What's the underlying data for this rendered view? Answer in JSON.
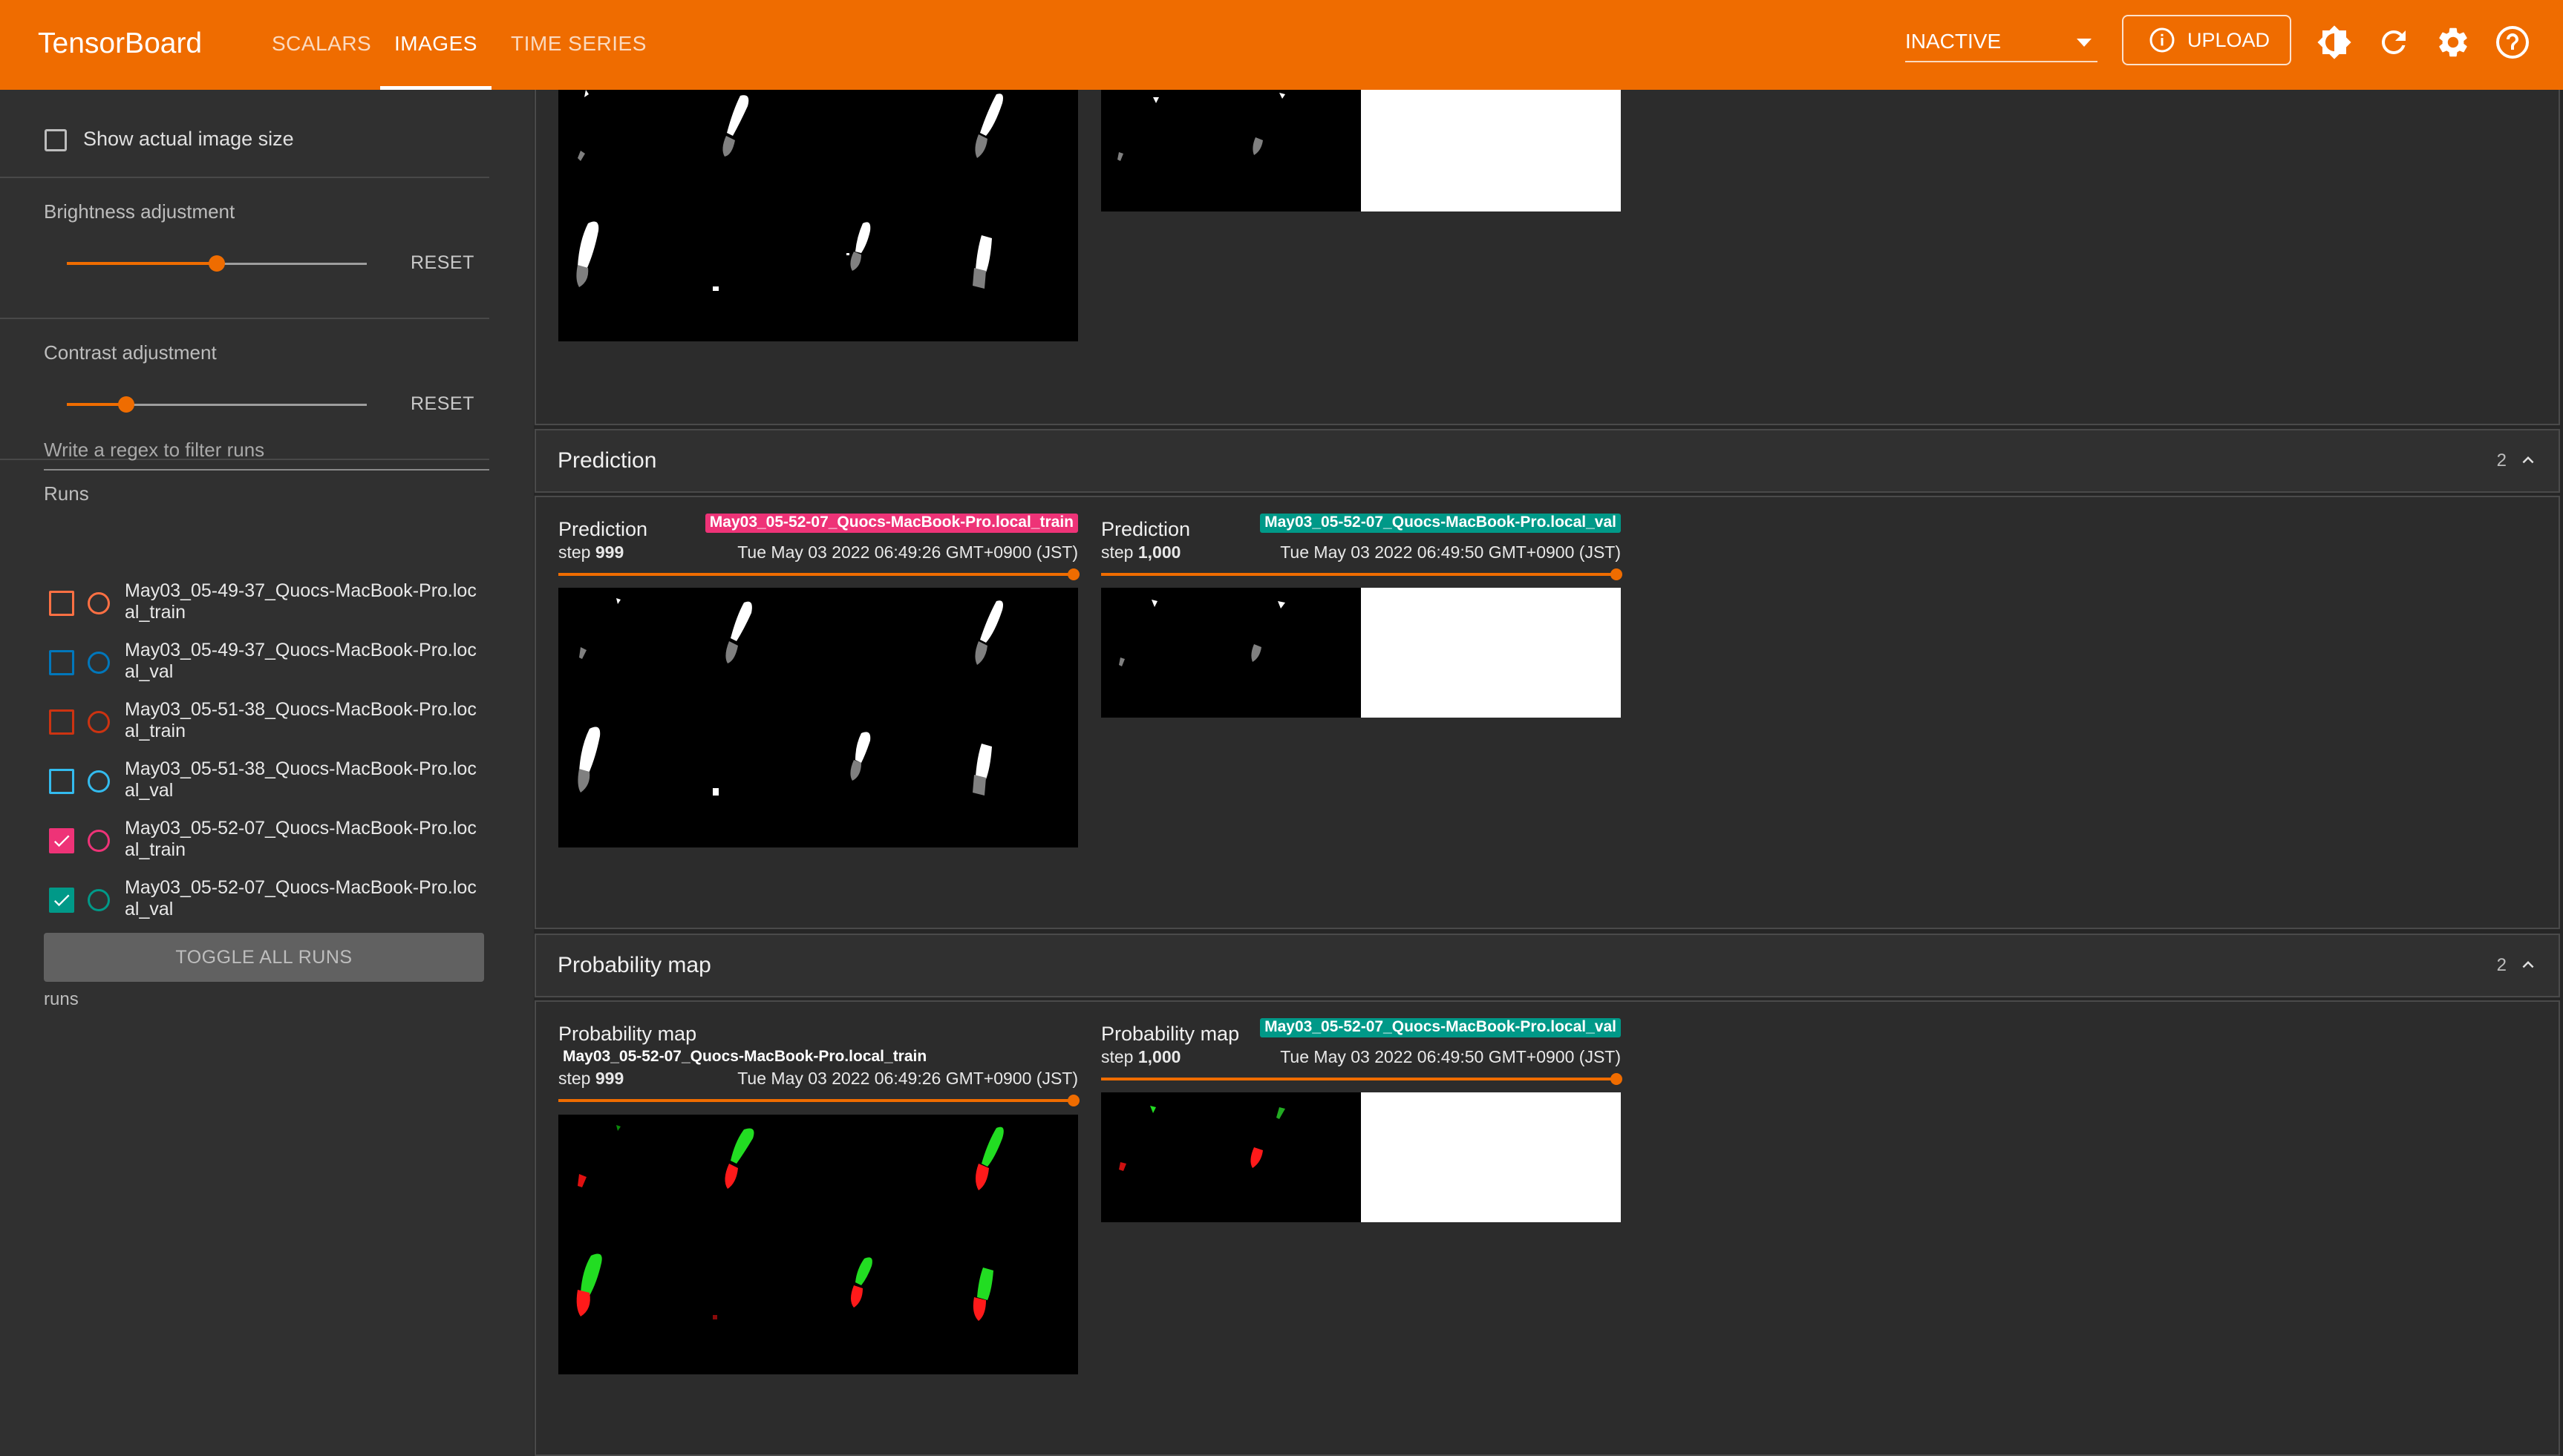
{
  "app": {
    "brand": "TensorBoard",
    "tabs": [
      {
        "label": "SCALARS",
        "active": false
      },
      {
        "label": "IMAGES",
        "active": true
      },
      {
        "label": "TIME SERIES",
        "active": false
      }
    ],
    "run_status": "INACTIVE",
    "upload_label": "UPLOAD",
    "accent": "#ef6c00"
  },
  "sidebar": {
    "show_actual_size_label": "Show actual image size",
    "brightness": {
      "label": "Brightness adjustment",
      "reset": "RESET",
      "value": 0.5
    },
    "contrast": {
      "label": "Contrast adjustment",
      "reset": "RESET",
      "value": 0.2
    },
    "runs_heading": "Runs",
    "filter_placeholder": "Write a regex to filter runs",
    "runs": [
      {
        "name": "May03_05-49-37_Quocs-MacBook-Pro.loc\nal_train",
        "color": "#ff7043",
        "checked": false
      },
      {
        "name": "May03_05-49-37_Quocs-MacBook-Pro.loc\nal_val",
        "color": "#0077bb",
        "checked": false
      },
      {
        "name": "May03_05-51-38_Quocs-MacBook-Pro.loc\nal_train",
        "color": "#cc3311",
        "checked": false
      },
      {
        "name": "May03_05-51-38_Quocs-MacBook-Pro.loc\nal_val",
        "color": "#33bbee",
        "checked": false
      },
      {
        "name": "May03_05-52-07_Quocs-MacBook-Pro.loc\nal_train",
        "color": "#ee3377",
        "checked": true
      },
      {
        "name": "May03_05-52-07_Quocs-MacBook-Pro.loc\nal_val",
        "color": "#009988",
        "checked": true
      }
    ],
    "toggle_all": "TOGGLE ALL RUNS",
    "runs_footer": "runs"
  },
  "groups": {
    "prediction": {
      "title": "Prediction",
      "count": "2",
      "cards": [
        {
          "title": "Prediction",
          "run": "May03_05-52-07_Quocs-MacBook-Pro.local_train",
          "step_label": "step",
          "step": "999",
          "time": "Tue May 03 2022 06:49:26 GMT+0900 (JST)"
        },
        {
          "title": "Prediction",
          "run": "May03_05-52-07_Quocs-MacBook-Pro.local_val",
          "step_label": "step",
          "step": "1,000",
          "time": "Tue May 03 2022 06:49:50 GMT+0900 (JST)"
        }
      ]
    },
    "probability": {
      "title": "Probability map",
      "count": "2",
      "cards": [
        {
          "title": "Probability map",
          "run": "May03_05-52-07_Quocs-MacBook-Pro.local_train",
          "step_label": "step",
          "step": "999",
          "time": "Tue May 03 2022 06:49:26 GMT+0900 (JST)"
        },
        {
          "title": "Probability map",
          "run": "May03_05-52-07_Quocs-MacBook-Pro.local_val",
          "step_label": "step",
          "step": "1,000",
          "time": "Tue May 03 2022 06:49:50 GMT+0900 (JST)"
        }
      ]
    }
  }
}
